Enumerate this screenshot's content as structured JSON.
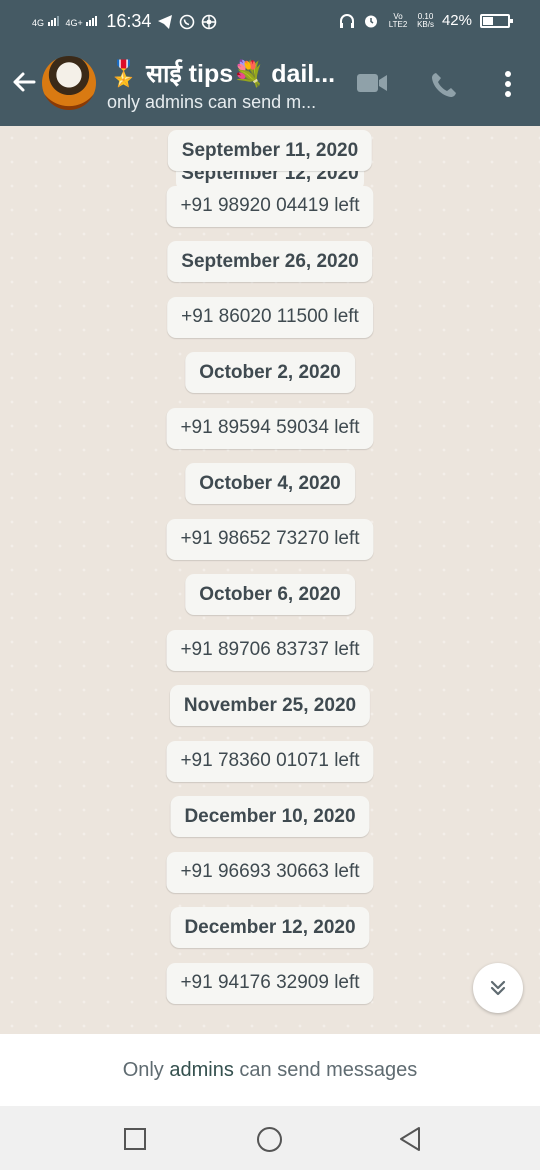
{
  "status_bar": {
    "net1": "4G",
    "net2": "4G+",
    "time": "16:34",
    "volte": "Vo LTE2",
    "speed_value": "0.10",
    "speed_unit": "KB/s",
    "battery": "42%",
    "battery_level": 0.42
  },
  "header": {
    "title": "🎖️ साई tips💐 dail...",
    "subtitle": "only admins can send m..."
  },
  "chat": {
    "peek_date": "September 12, 2020",
    "items": [
      {
        "type": "date",
        "text": "September 11, 2020"
      },
      {
        "type": "event",
        "text": "+91 98920 04419 left"
      },
      {
        "type": "date",
        "text": "September 26, 2020"
      },
      {
        "type": "event",
        "text": "+91 86020 11500 left"
      },
      {
        "type": "date",
        "text": "October 2, 2020"
      },
      {
        "type": "event",
        "text": "+91 89594 59034 left"
      },
      {
        "type": "date",
        "text": "October 4, 2020"
      },
      {
        "type": "event",
        "text": "+91 98652 73270 left"
      },
      {
        "type": "date",
        "text": "October 6, 2020"
      },
      {
        "type": "event",
        "text": "+91 89706 83737 left"
      },
      {
        "type": "date",
        "text": "November 25, 2020"
      },
      {
        "type": "event",
        "text": "+91 78360 01071 left"
      },
      {
        "type": "date",
        "text": "December 10, 2020"
      },
      {
        "type": "event",
        "text": "+91 96693 30663 left"
      },
      {
        "type": "date",
        "text": "December 12, 2020"
      },
      {
        "type": "event",
        "text": "+91 94176 32909 left"
      }
    ]
  },
  "footer": {
    "prefix": "Only ",
    "admins": "admins",
    "suffix": " can send messages"
  },
  "colors": {
    "header_bg": "#455a64",
    "chat_bg": "#ece5dd",
    "pill_bg": "#f6f6f3"
  },
  "icons": [
    "back-arrow-icon",
    "video-call-icon",
    "voice-call-icon",
    "more-options-icon",
    "scroll-down-icon",
    "recents-icon",
    "home-icon",
    "back-icon"
  ]
}
